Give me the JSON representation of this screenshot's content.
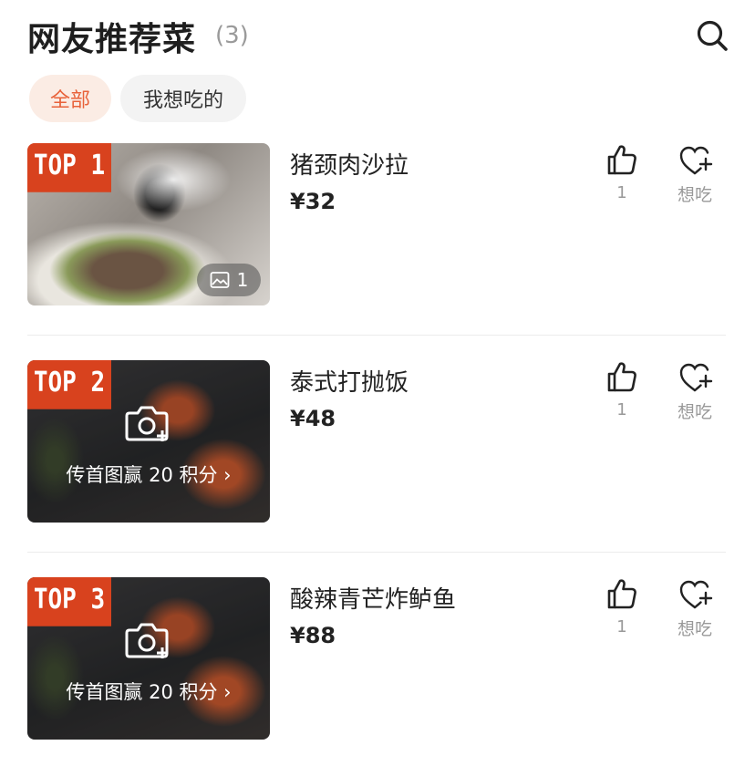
{
  "header": {
    "title": "网友推荐菜",
    "count": "(3)",
    "search_icon": "search-icon"
  },
  "tabs": [
    {
      "label": "全部",
      "active": true
    },
    {
      "label": "我想吃的",
      "active": false
    }
  ],
  "colors": {
    "accent": "#d8421e",
    "tab_active_bg": "#fbece4",
    "tab_active_text": "#e8623a",
    "muted": "#999999"
  },
  "dishes": [
    {
      "rank": "TOP 1",
      "name": "猪颈肉沙拉",
      "price": "¥32",
      "photo_count": "1",
      "likes": "1",
      "want_label": "想吃"
    },
    {
      "rank": "TOP 2",
      "name": "泰式打抛饭",
      "price": "¥48",
      "upload_text": "传首图赢 20 积分 ›",
      "likes": "1",
      "want_label": "想吃"
    },
    {
      "rank": "TOP 3",
      "name": "酸辣青芒炸鲈鱼",
      "price": "¥88",
      "upload_text": "传首图赢 20 积分 ›",
      "likes": "1",
      "want_label": "想吃"
    }
  ]
}
